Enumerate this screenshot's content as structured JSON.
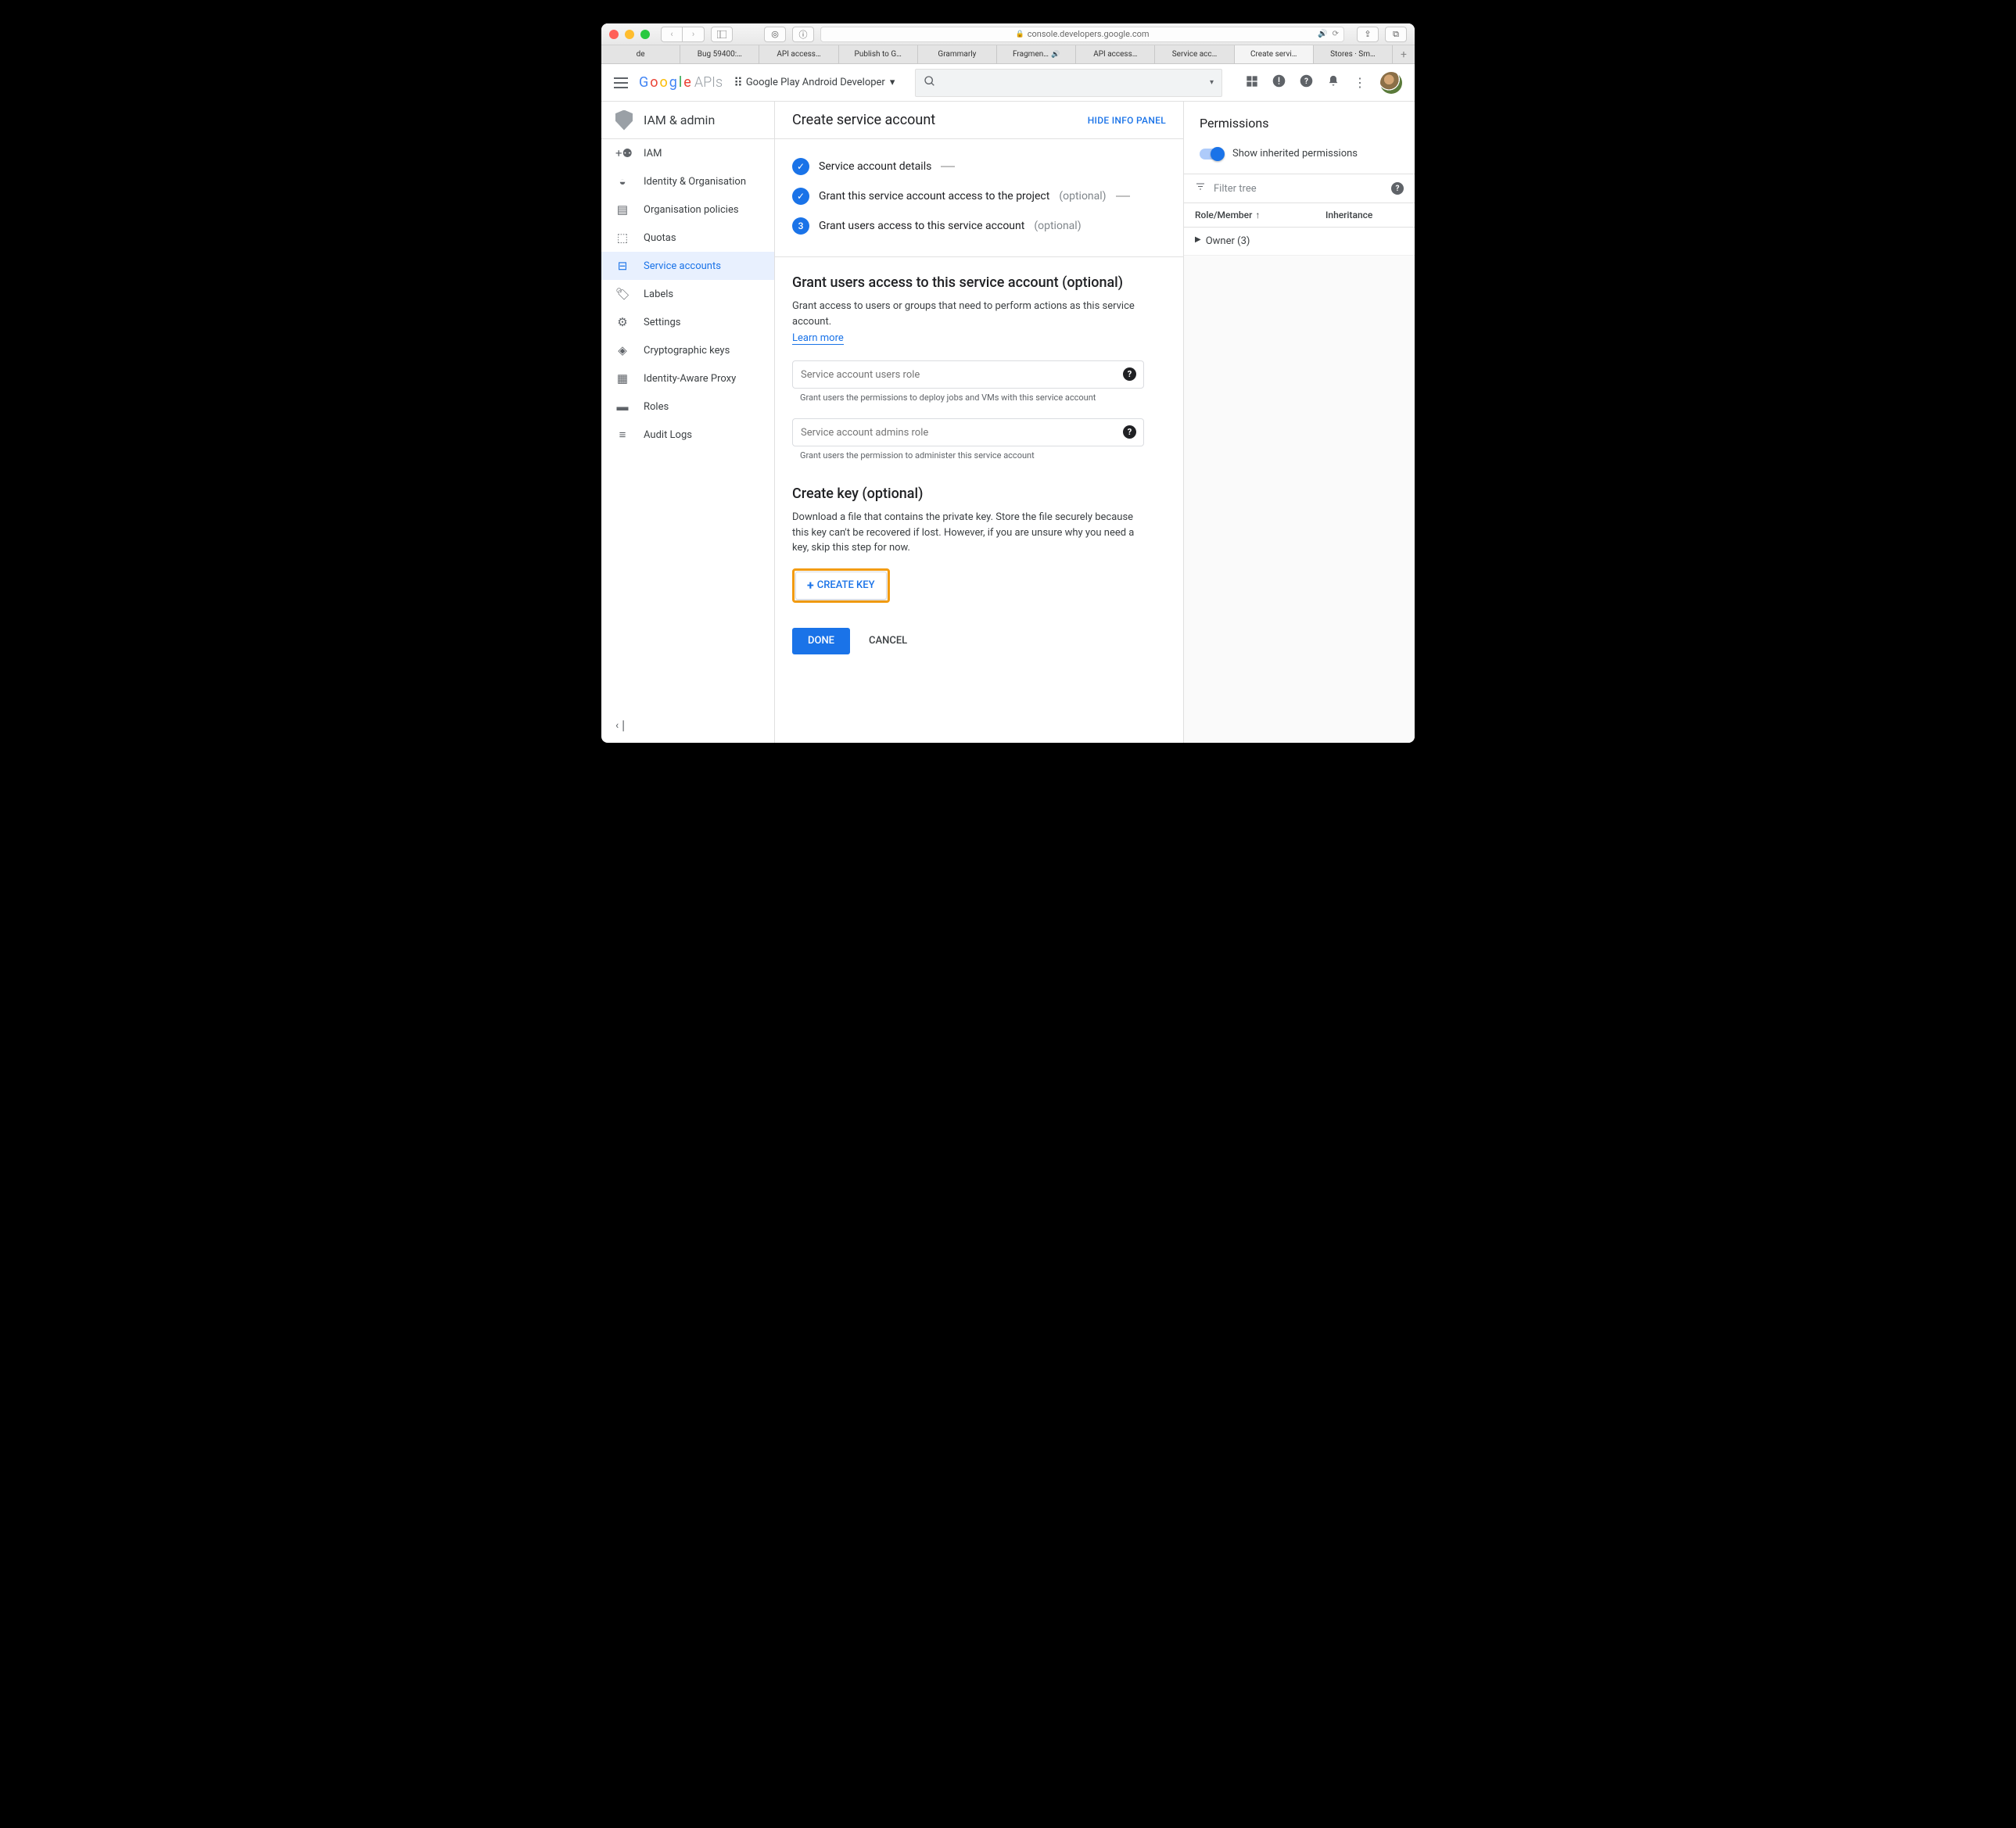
{
  "browser": {
    "url": "console.developers.google.com",
    "tabs": [
      "de",
      "Bug 59400:…",
      "API access…",
      "Publish to G…",
      "Grammarly",
      "Fragmen…",
      "API access…",
      "Service acc…",
      "Create servi…",
      "Stores · Sm…"
    ]
  },
  "header": {
    "logo_apis": "APIs",
    "project": "Google Play Android Developer"
  },
  "sidebar": {
    "title": "IAM & admin",
    "items": [
      {
        "label": "IAM"
      },
      {
        "label": "Identity & Organisation"
      },
      {
        "label": "Organisation policies"
      },
      {
        "label": "Quotas"
      },
      {
        "label": "Service accounts"
      },
      {
        "label": "Labels"
      },
      {
        "label": "Settings"
      },
      {
        "label": "Cryptographic keys"
      },
      {
        "label": "Identity-Aware Proxy"
      },
      {
        "label": "Roles"
      },
      {
        "label": "Audit Logs"
      }
    ]
  },
  "page": {
    "title": "Create service account",
    "hide_panel": "HIDE INFO PANEL",
    "steps": {
      "s1": "Service account details",
      "s2": "Grant this service account access to the project",
      "s2_opt": "(optional)",
      "s3": "Grant users access to this service account",
      "s3_opt": "(optional)",
      "s3_num": "3"
    },
    "grant": {
      "title": "Grant users access to this service account (optional)",
      "desc": "Grant access to users or groups that need to perform actions as this service account.",
      "learn": "Learn more",
      "f1_ph": "Service account users role",
      "f1_hint": "Grant users the permissions to deploy jobs and VMs with this service account",
      "f2_ph": "Service account admins role",
      "f2_hint": "Grant users the permission to administer this service account"
    },
    "key": {
      "title": "Create key (optional)",
      "desc": "Download a file that contains the private key. Store the file securely because this key can't be recovered if lost. However, if you are unsure why you need a key, skip this step for now.",
      "btn": "CREATE KEY"
    },
    "done": "DONE",
    "cancel": "CANCEL"
  },
  "rpanel": {
    "title": "Permissions",
    "toggle": "Show inherited permissions",
    "filter": "Filter tree",
    "col1": "Role/Member",
    "col2": "Inheritance",
    "row1": "Owner (3)"
  }
}
